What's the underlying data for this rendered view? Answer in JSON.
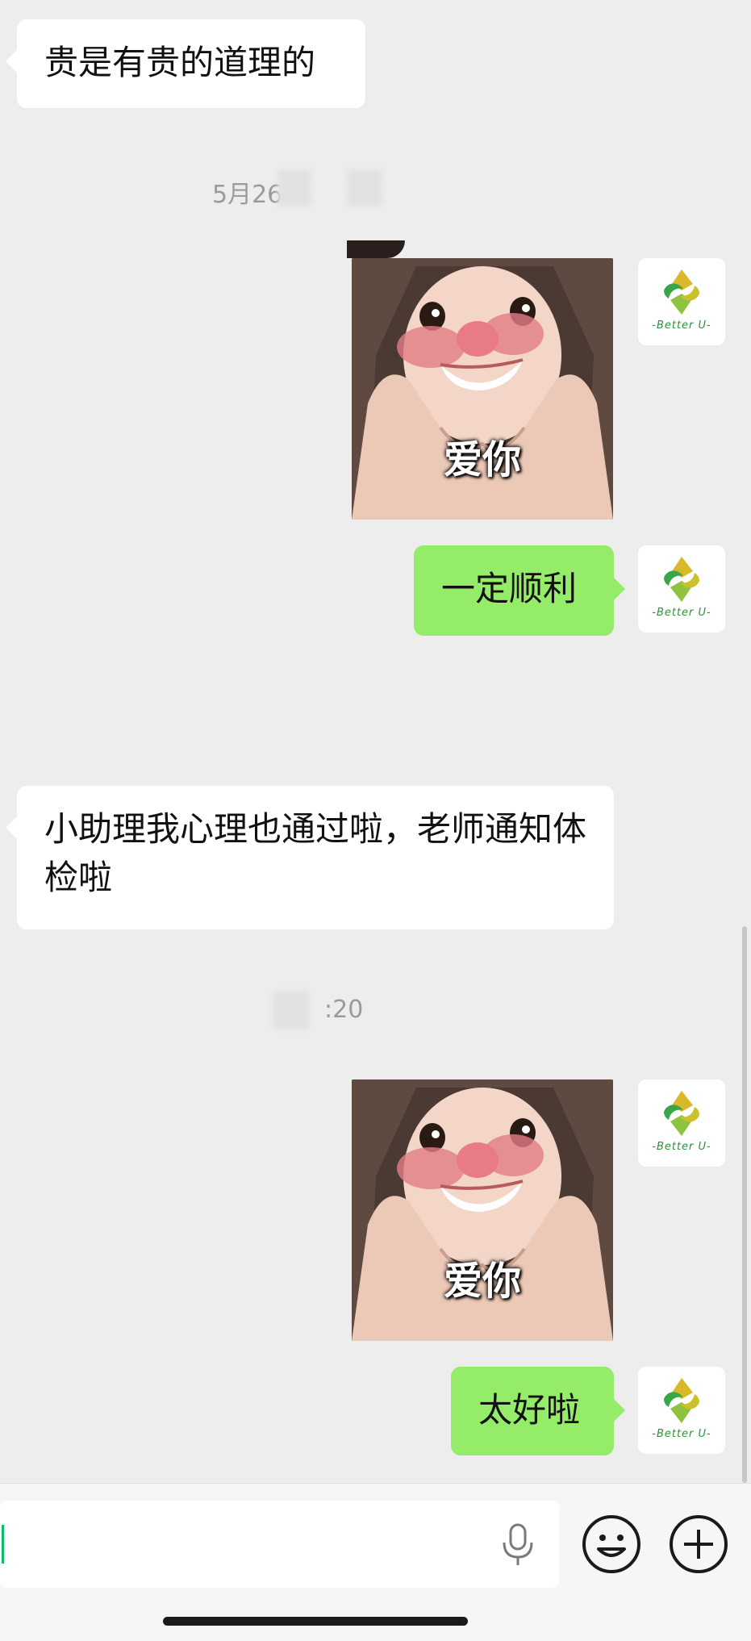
{
  "avatar": {
    "brand_text": "-Better U-"
  },
  "messages": [
    {
      "text": "贵是有贵的道理的"
    },
    {
      "text": "一定顺利"
    },
    {
      "text": "小助理我心理也通过啦，老师通知体检啦"
    },
    {
      "text": "太好啦"
    }
  ],
  "timestamps": [
    {
      "text": "5月26"
    },
    {
      "text": ":20"
    }
  ],
  "stickers": [
    {
      "caption": "爱你"
    },
    {
      "caption": "爱你"
    }
  ],
  "colors": {
    "background": "#ededed",
    "incoming_bubble": "#ffffff",
    "outgoing_bubble": "#95ec69",
    "caret": "#07c160"
  },
  "input_bar": {
    "icons": [
      "microphone-icon",
      "emoji-icon",
      "plus-icon"
    ]
  }
}
